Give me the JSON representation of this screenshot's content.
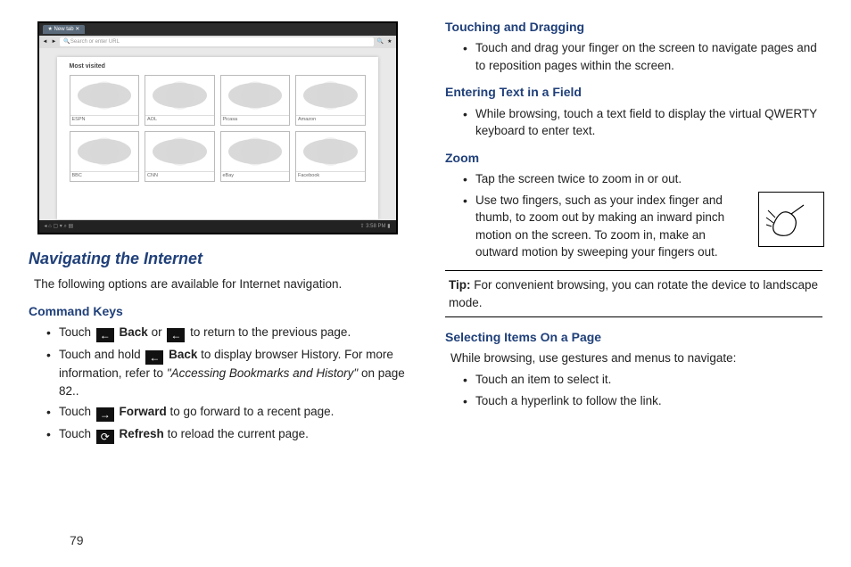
{
  "screenshot": {
    "tab_label": "New tab",
    "url_placeholder": "Search or enter URL",
    "most_visited_label": "Most visited",
    "thumbs": [
      "ESPN",
      "AOL",
      "Picasa",
      "Amazon",
      "BBC",
      "CNN",
      "eBay",
      "Facebook"
    ],
    "time": "3:58 PM"
  },
  "left": {
    "section_title": "Navigating the Internet",
    "intro": "The following options are available for Internet navigation.",
    "command_keys_title": "Command Keys",
    "ck1_a": "Touch ",
    "ck1_b": " Back",
    "ck1_c": " or ",
    "ck1_d": " to return to the previous page.",
    "ck2_a": "Touch and hold ",
    "ck2_b": " Back",
    "ck2_c": " to display browser History. For more information, refer to ",
    "ck2_ref": "\"Accessing Bookmarks and History\"",
    "ck2_d": " on page 82..",
    "ck3_a": "Touch ",
    "ck3_b": " Forward",
    "ck3_c": " to go forward to a recent page.",
    "ck4_a": "Touch ",
    "ck4_b": " Refresh",
    "ck4_c": " to reload the current page."
  },
  "right": {
    "touch_drag_title": "Touching and Dragging",
    "touch_drag_item": "Touch and drag your finger on the screen to navigate pages and to reposition pages within the screen.",
    "enter_text_title": "Entering Text in a Field",
    "enter_text_item": "While browsing, touch a text field to display the virtual QWERTY keyboard to enter text.",
    "zoom_title": "Zoom",
    "zoom_item1": "Tap the screen twice to zoom in or out.",
    "zoom_item2": "Use two fingers, such as your index finger and thumb, to zoom out by making an inward pinch motion on the screen. To zoom in, make an outward motion by sweeping your fingers out.",
    "tip_label": "Tip:",
    "tip_text": " For convenient browsing, you can rotate the device to landscape mode.",
    "select_title": "Selecting Items On a Page",
    "select_intro": "While browsing, use gestures and menus to navigate:",
    "select_item1": "Touch an item to select it.",
    "select_item2": "Touch a hyperlink to follow the link."
  },
  "page_number": "79"
}
